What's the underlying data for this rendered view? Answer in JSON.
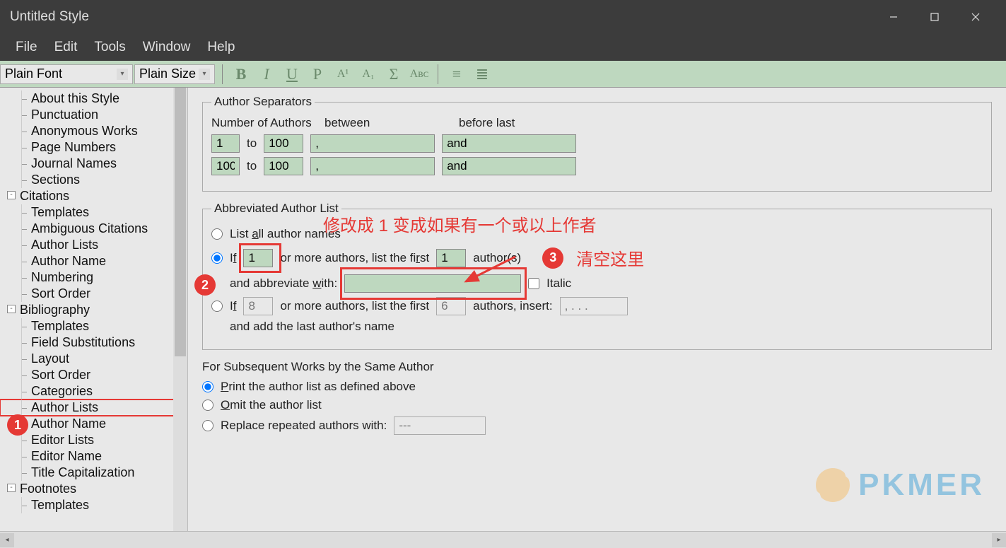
{
  "window": {
    "title": "Untitled Style"
  },
  "menubar": {
    "items": [
      "File",
      "Edit",
      "Tools",
      "Window",
      "Help"
    ]
  },
  "toolbar": {
    "font_combo": "Plain Font",
    "size_combo": "Plain Size",
    "buttons": {
      "bold": "B",
      "italic": "I",
      "underline": "U",
      "plain": "P",
      "sup": "A¹",
      "sub": "A₁",
      "sigma": "Σ",
      "smallcaps": "Aʙᴄ"
    }
  },
  "tree": {
    "items": [
      {
        "label": "About this Style",
        "level": "child"
      },
      {
        "label": "Punctuation",
        "level": "child"
      },
      {
        "label": "Anonymous Works",
        "level": "child"
      },
      {
        "label": "Page Numbers",
        "level": "child"
      },
      {
        "label": "Journal Names",
        "level": "child"
      },
      {
        "label": "Sections",
        "level": "child"
      },
      {
        "label": "Citations",
        "level": "group",
        "exp": "-"
      },
      {
        "label": "Templates",
        "level": "child"
      },
      {
        "label": "Ambiguous Citations",
        "level": "child"
      },
      {
        "label": "Author Lists",
        "level": "child"
      },
      {
        "label": "Author Name",
        "level": "child"
      },
      {
        "label": "Numbering",
        "level": "child"
      },
      {
        "label": "Sort Order",
        "level": "child"
      },
      {
        "label": "Bibliography",
        "level": "group",
        "exp": "-"
      },
      {
        "label": "Templates",
        "level": "child"
      },
      {
        "label": "Field Substitutions",
        "level": "child"
      },
      {
        "label": "Layout",
        "level": "child"
      },
      {
        "label": "Sort Order",
        "level": "child"
      },
      {
        "label": "Categories",
        "level": "child"
      },
      {
        "label": "Author Lists",
        "level": "child",
        "selected": true
      },
      {
        "label": "Author Name",
        "level": "child"
      },
      {
        "label": "Editor Lists",
        "level": "child"
      },
      {
        "label": "Editor Name",
        "level": "child"
      },
      {
        "label": "Title Capitalization",
        "level": "child"
      },
      {
        "label": "Footnotes",
        "level": "group",
        "exp": "-"
      },
      {
        "label": "Templates",
        "level": "child"
      }
    ]
  },
  "author_separators": {
    "legend": "Author Separators",
    "header_num": "Number of Authors",
    "header_between": "between",
    "header_before": "before last",
    "to_label": "to",
    "row1": {
      "from": "1",
      "to": "100",
      "between": ",",
      "before": "and"
    },
    "row2": {
      "from": "100",
      "to": "100",
      "between": ",",
      "before": "and"
    }
  },
  "abbreviated": {
    "legend": "Abbreviated Author List",
    "opt_all": "List all author names",
    "opt_if": "If",
    "if_val": "1",
    "or_more": "or more authors, list the first",
    "first_val": "1",
    "authors": "author(s)",
    "abbrev_with": "and abbreviate with:",
    "abbrev_val": "",
    "italic": "Italic",
    "opt_if2": "If",
    "if2_val": "8",
    "or_more2": "or more authors, list the first",
    "first2_val": "6",
    "insert": "authors, insert:",
    "insert_val": ", . . .",
    "add_last": "and add the last author's name"
  },
  "subsequent": {
    "legend": "For Subsequent Works by the Same Author",
    "opt_print": "Print the author list as defined above",
    "opt_omit": "Omit the author list",
    "opt_replace": "Replace repeated authors with:",
    "replace_val": "---"
  },
  "annotations": {
    "badge1": "1",
    "badge2": "2",
    "badge3": "3",
    "text_top": "修改成 1 变成如果有一个或以上作者",
    "text_right": "清空这里"
  },
  "watermark": "PKMER"
}
